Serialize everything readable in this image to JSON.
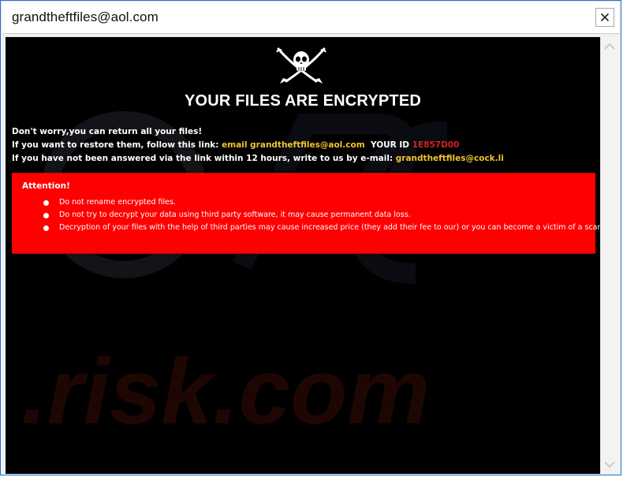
{
  "window": {
    "title": "grandtheftfiles@aol.com"
  },
  "message": {
    "heading": "YOUR FILES ARE ENCRYPTED",
    "line1": "Don't worry,you can return all your files!",
    "line2_prefix": "If you want to restore them, follow this link:",
    "line2_email": "email grandtheftfiles@aol.com",
    "line2_id_label": "YOUR ID",
    "line2_id_value": "1E857D00",
    "line3_prefix": "If you have not been answered via the link within 12 hours, write to us by e-mail:",
    "line3_email": "grandtheftfiles@cock.li"
  },
  "attention": {
    "title": "Attention!",
    "items": [
      "Do not rename encrypted files.",
      "Do not try to decrypt your data using third party software, it may cause permanent data loss.",
      "Decryption of your files with the help of third parties may cause increased price (they add their fee to our) or you can become a victim of a scam."
    ]
  },
  "watermark": {
    "text": ".risk.com"
  },
  "icons": {
    "close": "close-icon",
    "skull": "skull-crossed-swords-icon",
    "scroll_up": "chevron-up-icon",
    "scroll_down": "chevron-down-icon"
  },
  "colors": {
    "accent_yellow": "#f2c22f",
    "id_red": "#d62020",
    "alert_box": "#ff0000",
    "window_border": "#1e6fcc"
  }
}
